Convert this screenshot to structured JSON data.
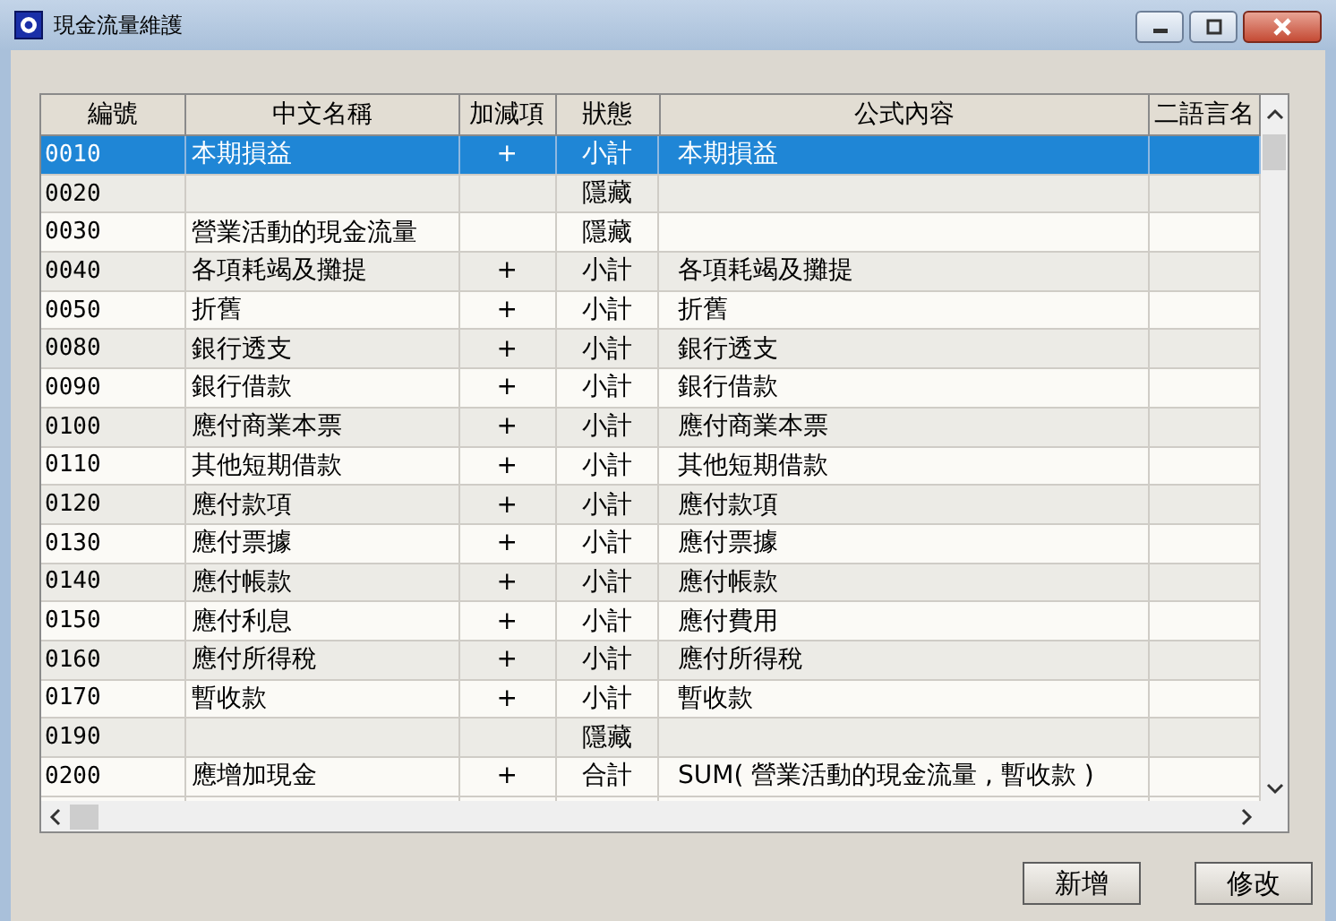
{
  "window": {
    "title": "現金流量維護"
  },
  "table": {
    "columns": [
      "編號",
      "中文名稱",
      "加減項",
      "狀態",
      "公式內容",
      "二語言名"
    ],
    "rows": [
      {
        "code": "0010",
        "name": "本期損益",
        "sign": "+",
        "status": "小計",
        "formula": "本期損益",
        "selected": true
      },
      {
        "code": "0020",
        "status": "隱藏",
        "selected": false
      },
      {
        "code": "0030",
        "name": "營業活動的現金流量",
        "status": "隱藏",
        "selected": false
      },
      {
        "code": "0040",
        "name": "各項耗竭及攤提",
        "sign": "+",
        "status": "小計",
        "formula": "各項耗竭及攤提",
        "selected": false
      },
      {
        "code": "0050",
        "name": "折舊",
        "sign": "+",
        "status": "小計",
        "formula": "折舊",
        "selected": false
      },
      {
        "code": "0080",
        "name": "銀行透支",
        "sign": "+",
        "status": "小計",
        "formula": "銀行透支",
        "selected": false
      },
      {
        "code": "0090",
        "name": "銀行借款",
        "sign": "+",
        "status": "小計",
        "formula": "銀行借款",
        "selected": false
      },
      {
        "code": "0100",
        "name": "應付商業本票",
        "sign": "+",
        "status": "小計",
        "formula": "應付商業本票",
        "selected": false
      },
      {
        "code": "0110",
        "name": "其他短期借款",
        "sign": "+",
        "status": "小計",
        "formula": "其他短期借款",
        "selected": false
      },
      {
        "code": "0120",
        "name": "應付款項",
        "sign": "+",
        "status": "小計",
        "formula": "應付款項",
        "selected": false
      },
      {
        "code": "0130",
        "name": "應付票據",
        "sign": "+",
        "status": "小計",
        "formula": "應付票據",
        "selected": false
      },
      {
        "code": "0140",
        "name": "應付帳款",
        "sign": "+",
        "status": "小計",
        "formula": "應付帳款",
        "selected": false
      },
      {
        "code": "0150",
        "name": "應付利息",
        "sign": "+",
        "status": "小計",
        "formula": "應付費用",
        "selected": false
      },
      {
        "code": "0160",
        "name": "應付所得稅",
        "sign": "+",
        "status": "小計",
        "formula": "應付所得稅",
        "selected": false
      },
      {
        "code": "0170",
        "name": "暫收款",
        "sign": "+",
        "status": "小計",
        "formula": "暫收款",
        "selected": false
      },
      {
        "code": "0190",
        "status": "隱藏",
        "selected": false
      },
      {
        "code": "0200",
        "name": "應增加現金",
        "sign": "+",
        "status": "合計",
        "formula": "SUM( 營業活動的現金流量 , 暫收款 )",
        "selected": false
      }
    ]
  },
  "buttons": [
    "新增",
    "修改"
  ]
}
